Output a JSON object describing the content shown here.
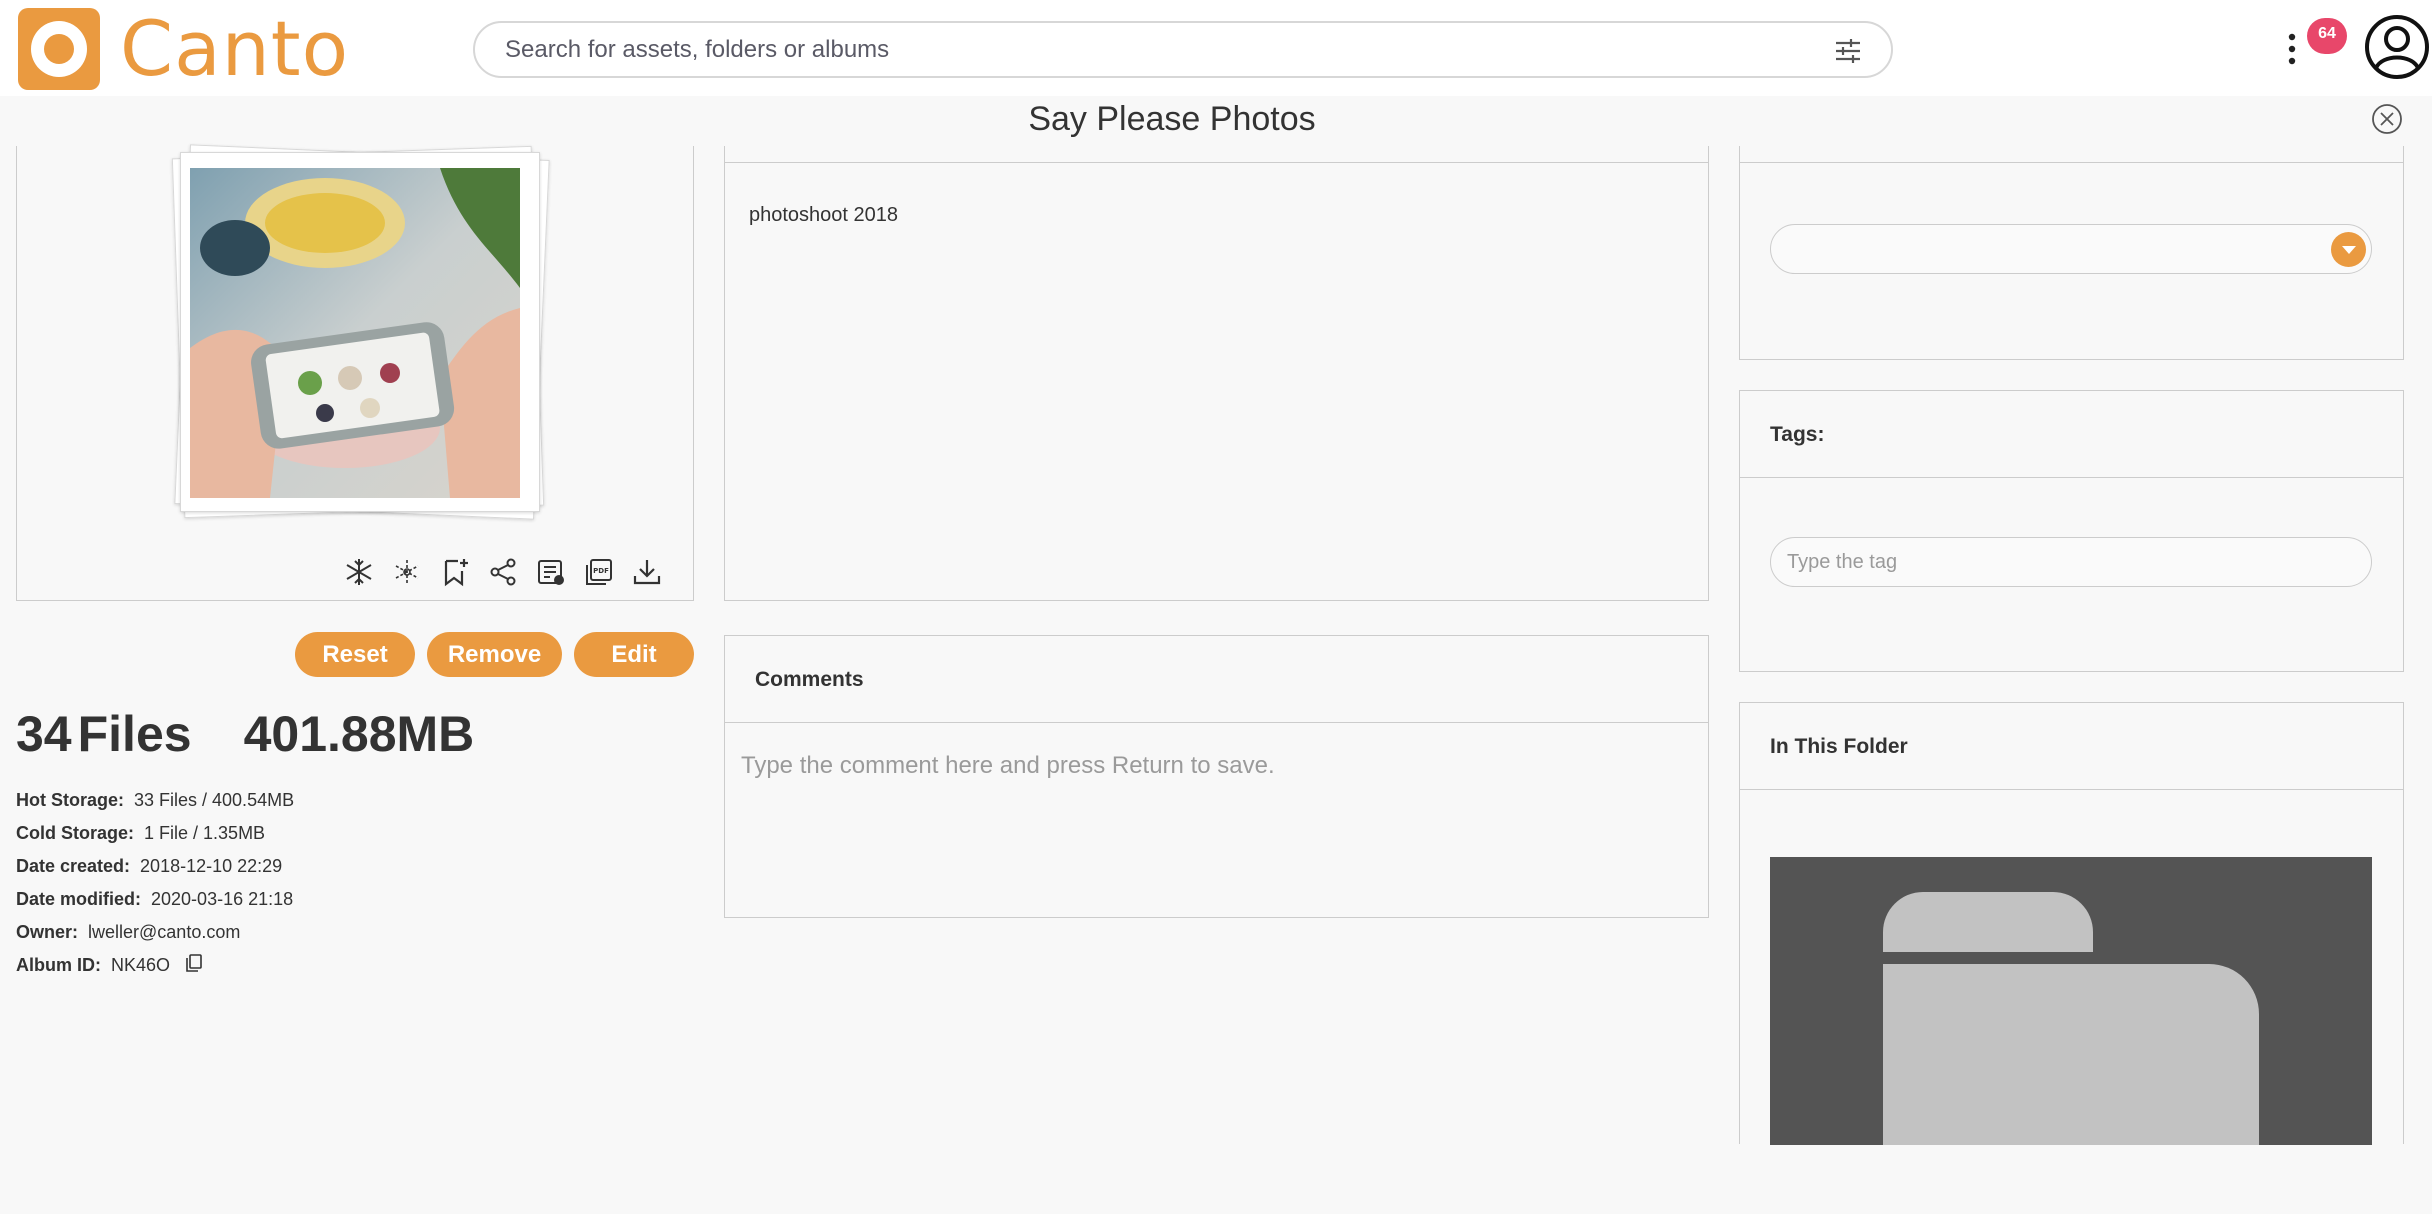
{
  "app": {
    "logo_text": "Canto",
    "brand_color": "#ea9a40",
    "notification_count": "64"
  },
  "search": {
    "placeholder": "Search for assets, folders or albums"
  },
  "album": {
    "title": "Say Please Photos",
    "description": "photoshoot 2018"
  },
  "buttons": {
    "reset": "Reset",
    "remove": "Remove",
    "edit": "Edit"
  },
  "toolbar_icons": [
    "snowflake-icon",
    "thaw-icon",
    "bookmark-add-icon",
    "share-icon",
    "metadata-icon",
    "pdf-icon",
    "download-icon"
  ],
  "totals": {
    "files_count": "34",
    "files_label": "Files",
    "size": "401.88MB"
  },
  "meta": {
    "hot_storage_label": "Hot Storage:",
    "hot_storage_value": "33 Files / 400.54MB",
    "cold_storage_label": "Cold Storage:",
    "cold_storage_value": "1 File / 1.35MB",
    "date_created_label": "Date created:",
    "date_created_value": "2018-12-10 22:29",
    "date_modified_label": "Date modified:",
    "date_modified_value": "2020-03-16 21:18",
    "owner_label": "Owner:",
    "owner_value": "lweller@canto.com",
    "album_id_label": "Album ID:",
    "album_id_value": "NK46O"
  },
  "comments": {
    "heading": "Comments",
    "placeholder": "Type the comment here and press Return to save."
  },
  "tags": {
    "heading": "Tags:",
    "placeholder": "Type the tag"
  },
  "folder": {
    "heading": "In This Folder"
  }
}
